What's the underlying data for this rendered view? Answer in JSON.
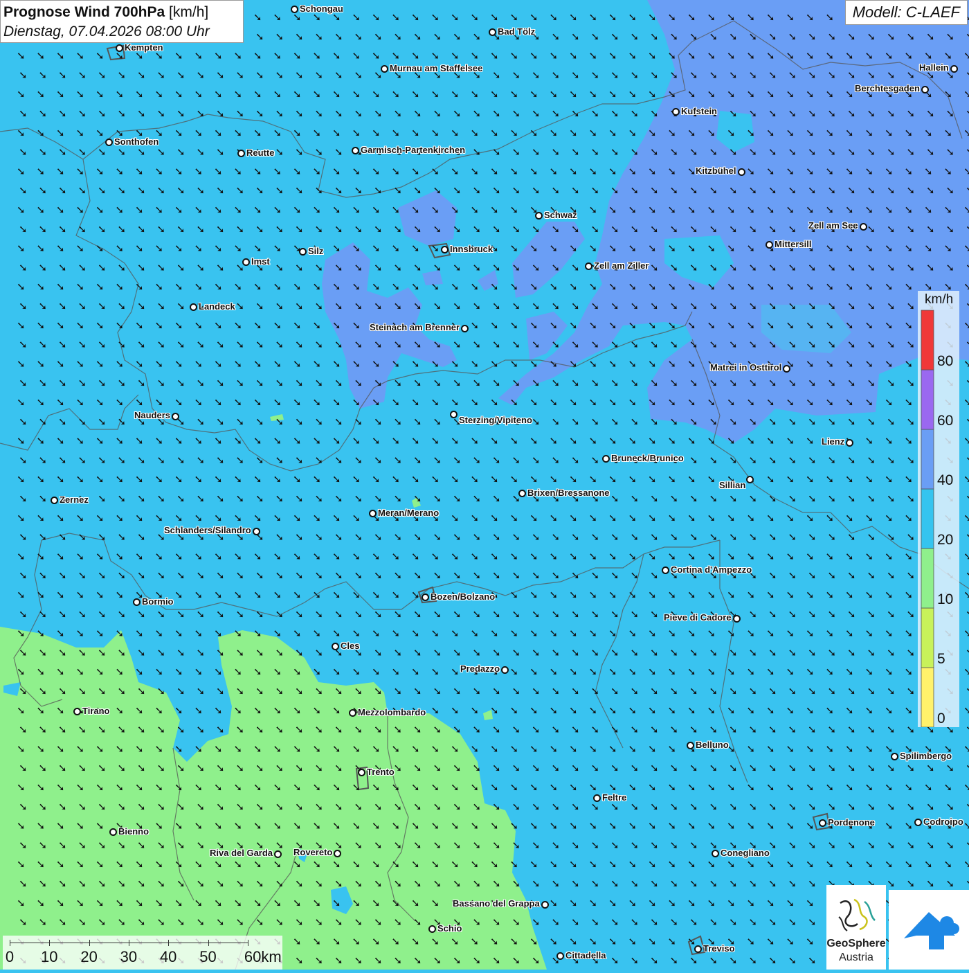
{
  "title": {
    "bold": "Prognose Wind 700hPa",
    "unit": "[km/h]",
    "datetime": "Dienstag, 07.04.2026 08:00 Uhr"
  },
  "model": "Modell: C-LAEF",
  "legend": {
    "unit": "km/h",
    "ticks": [
      "0",
      "5",
      "10",
      "20",
      "40",
      "60",
      "80"
    ],
    "colors": [
      "#fff26b",
      "#c8f25a",
      "#8ff08c",
      "#35c4ef",
      "#6a9ef5",
      "#9a68f0",
      "#f03838"
    ]
  },
  "scalebar": {
    "labels": [
      "0",
      "10",
      "20",
      "30",
      "40",
      "50",
      "60km"
    ]
  },
  "logos": {
    "geosphere_line1": "GeoSphere",
    "geosphere_line2": "Austria"
  },
  "colors": {
    "wind_10_20": "#8ff08c",
    "wind_20_40": "#39c3f0",
    "wind_40_60": "#6a9ef5",
    "wind_40_60_light": "#56b4f2"
  },
  "wind": {
    "direction": "northwest",
    "arrow_glyph": "➘"
  },
  "cities": [
    {
      "name": "Schongau"
    },
    {
      "name": "Bad Tölz"
    },
    {
      "name": "Kempten"
    },
    {
      "name": "Murnau am Staffelsee"
    },
    {
      "name": "Hallein"
    },
    {
      "name": "Berchtesgaden"
    },
    {
      "name": "Kufstein"
    },
    {
      "name": "Sonthofen"
    },
    {
      "name": "Reutte"
    },
    {
      "name": "Garmisch-Partenkirchen"
    },
    {
      "name": "Kitzbühel"
    },
    {
      "name": "Schwaz"
    },
    {
      "name": "Zell am See"
    },
    {
      "name": "Mittersill"
    },
    {
      "name": "Silz"
    },
    {
      "name": "Innsbruck"
    },
    {
      "name": "Imst"
    },
    {
      "name": "Zell am Ziller"
    },
    {
      "name": "Landeck"
    },
    {
      "name": "Steinach am Brenner"
    },
    {
      "name": "Matrei in Osttirol"
    },
    {
      "name": "Nauders"
    },
    {
      "name": "Sterzing/Vipiteno"
    },
    {
      "name": "Lienz"
    },
    {
      "name": "Bruneck/Brunico"
    },
    {
      "name": "Sillian"
    },
    {
      "name": "Brixen/Bressanone"
    },
    {
      "name": "Zernez"
    },
    {
      "name": "Meran/Merano"
    },
    {
      "name": "Schlanders/Silandro"
    },
    {
      "name": "Cortina d'Ampezzo"
    },
    {
      "name": "Bozen/Bolzano"
    },
    {
      "name": "Bormio"
    },
    {
      "name": "Pieve di Cadore"
    },
    {
      "name": "Cles"
    },
    {
      "name": "Predazzo"
    },
    {
      "name": "Tirano"
    },
    {
      "name": "Mezzolombardo"
    },
    {
      "name": "Belluno"
    },
    {
      "name": "Spilimbergo"
    },
    {
      "name": "Trento"
    },
    {
      "name": "Feltre"
    },
    {
      "name": "Pordenone"
    },
    {
      "name": "Codroipo"
    },
    {
      "name": "Bienno"
    },
    {
      "name": "Riva del Garda"
    },
    {
      "name": "Rovereto"
    },
    {
      "name": "Conegliano"
    },
    {
      "name": "Bassano del Grappa"
    },
    {
      "name": "Schio"
    },
    {
      "name": "Treviso"
    },
    {
      "name": "Cittadella"
    }
  ]
}
